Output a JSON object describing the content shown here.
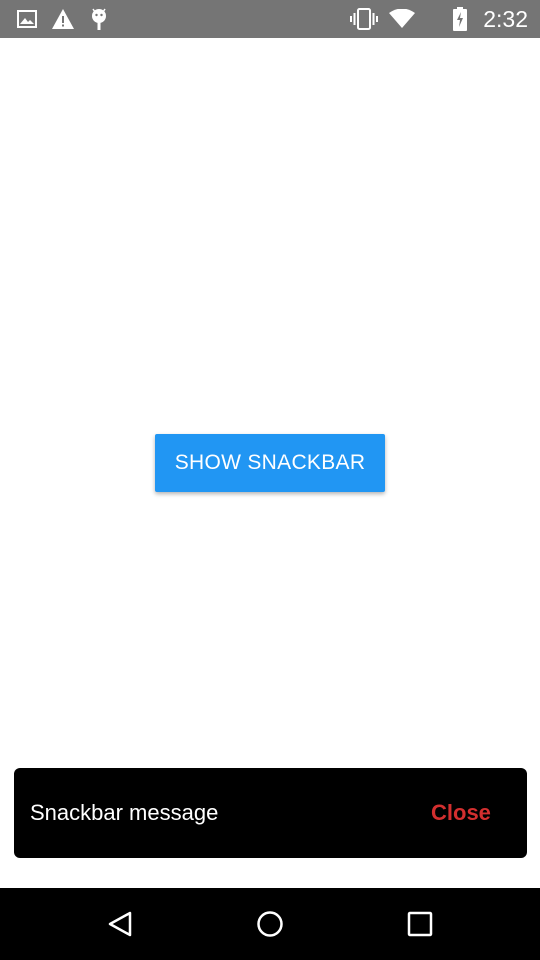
{
  "status_bar": {
    "time": "2:32",
    "left_icons": [
      "image-icon",
      "warning-icon",
      "android-debug-icon"
    ],
    "right_icons": [
      "vibrate-icon",
      "wifi-icon",
      "battery-icon"
    ]
  },
  "main": {
    "button_label": "SHOW SNACKBAR"
  },
  "snackbar": {
    "message": "Snackbar message",
    "action_label": "Close"
  },
  "nav_bar": {
    "buttons": [
      "back-icon",
      "home-icon",
      "recents-icon"
    ]
  },
  "colors": {
    "status_bar": "#757575",
    "button": "#2196f3",
    "snackbar_bg": "#000000",
    "snackbar_action": "#d32f2f",
    "nav_bar": "#000000"
  }
}
